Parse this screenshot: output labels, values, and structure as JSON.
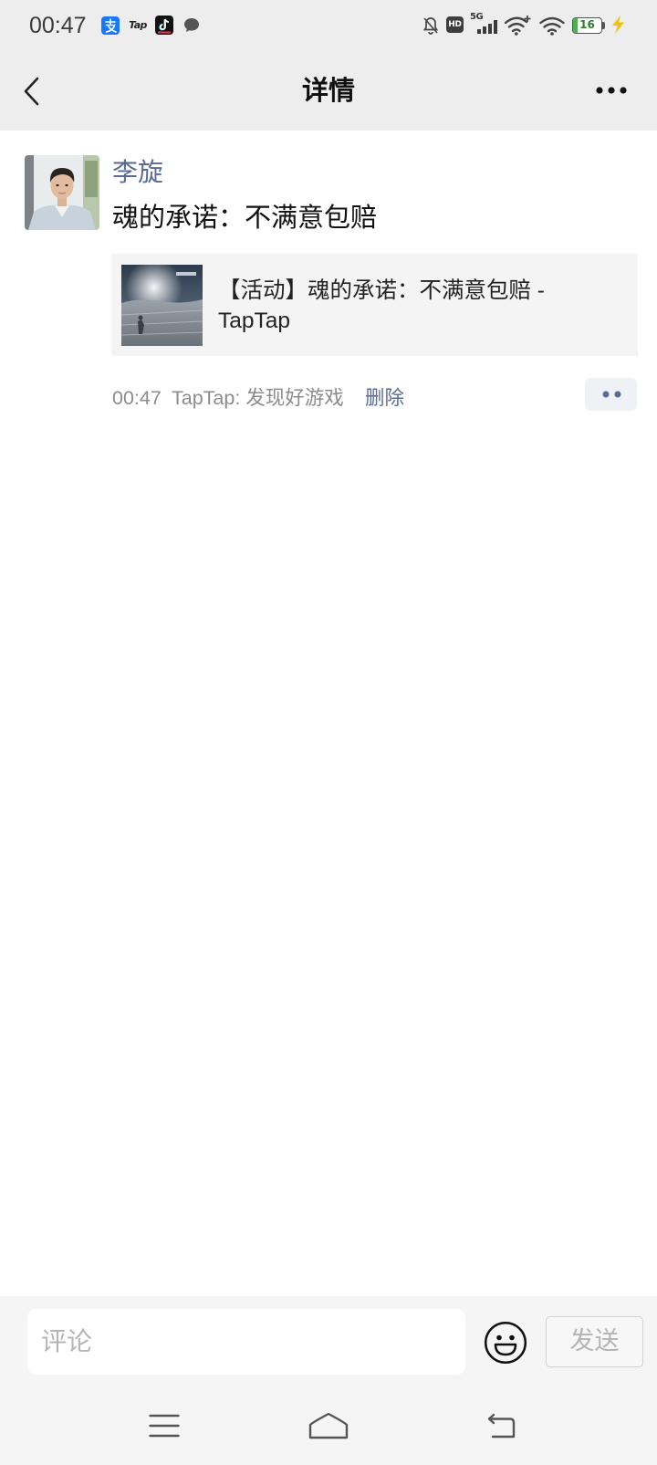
{
  "status_bar": {
    "time": "00:47",
    "app_icons": [
      "alipay-icon",
      "taptap-icon",
      "tiktok-icon",
      "chat-bubble-icon"
    ],
    "tap_logo_text": "Tap",
    "system_icons": [
      "bell-off-icon",
      "hd-icon",
      "signal-5g-icon",
      "wifi-plus-icon",
      "wifi-icon",
      "battery-icon",
      "charging-bolt-icon"
    ],
    "hd_label": "HD",
    "network_label": "5G",
    "battery_level": "16",
    "charging": true
  },
  "header": {
    "title": "详情",
    "back_icon": "chevron-left-icon",
    "more_icon": "more-horizontal-icon"
  },
  "post": {
    "author": "李旋",
    "text": "魂的承诺：不满意包赔",
    "link_card": {
      "title": "【活动】魂的承诺：不满意包赔 - TapTap"
    },
    "time": "00:47",
    "source": "TapTap: 发现好游戏",
    "delete_label": "删除",
    "actions_icon": "two-dots-icon"
  },
  "comment_bar": {
    "placeholder": "评论",
    "emoji_icon": "smiley-icon",
    "send_label": "发送"
  },
  "nav_bar": {
    "icons": [
      "menu-icon",
      "home-icon",
      "return-icon"
    ]
  },
  "colors": {
    "accent": "#576b95",
    "header_bg": "#ededed",
    "card_bg": "#f4f4f4",
    "battery": "#4caf50",
    "charging": "#f2c200",
    "send_disabled_text": "#b4b4b4"
  }
}
